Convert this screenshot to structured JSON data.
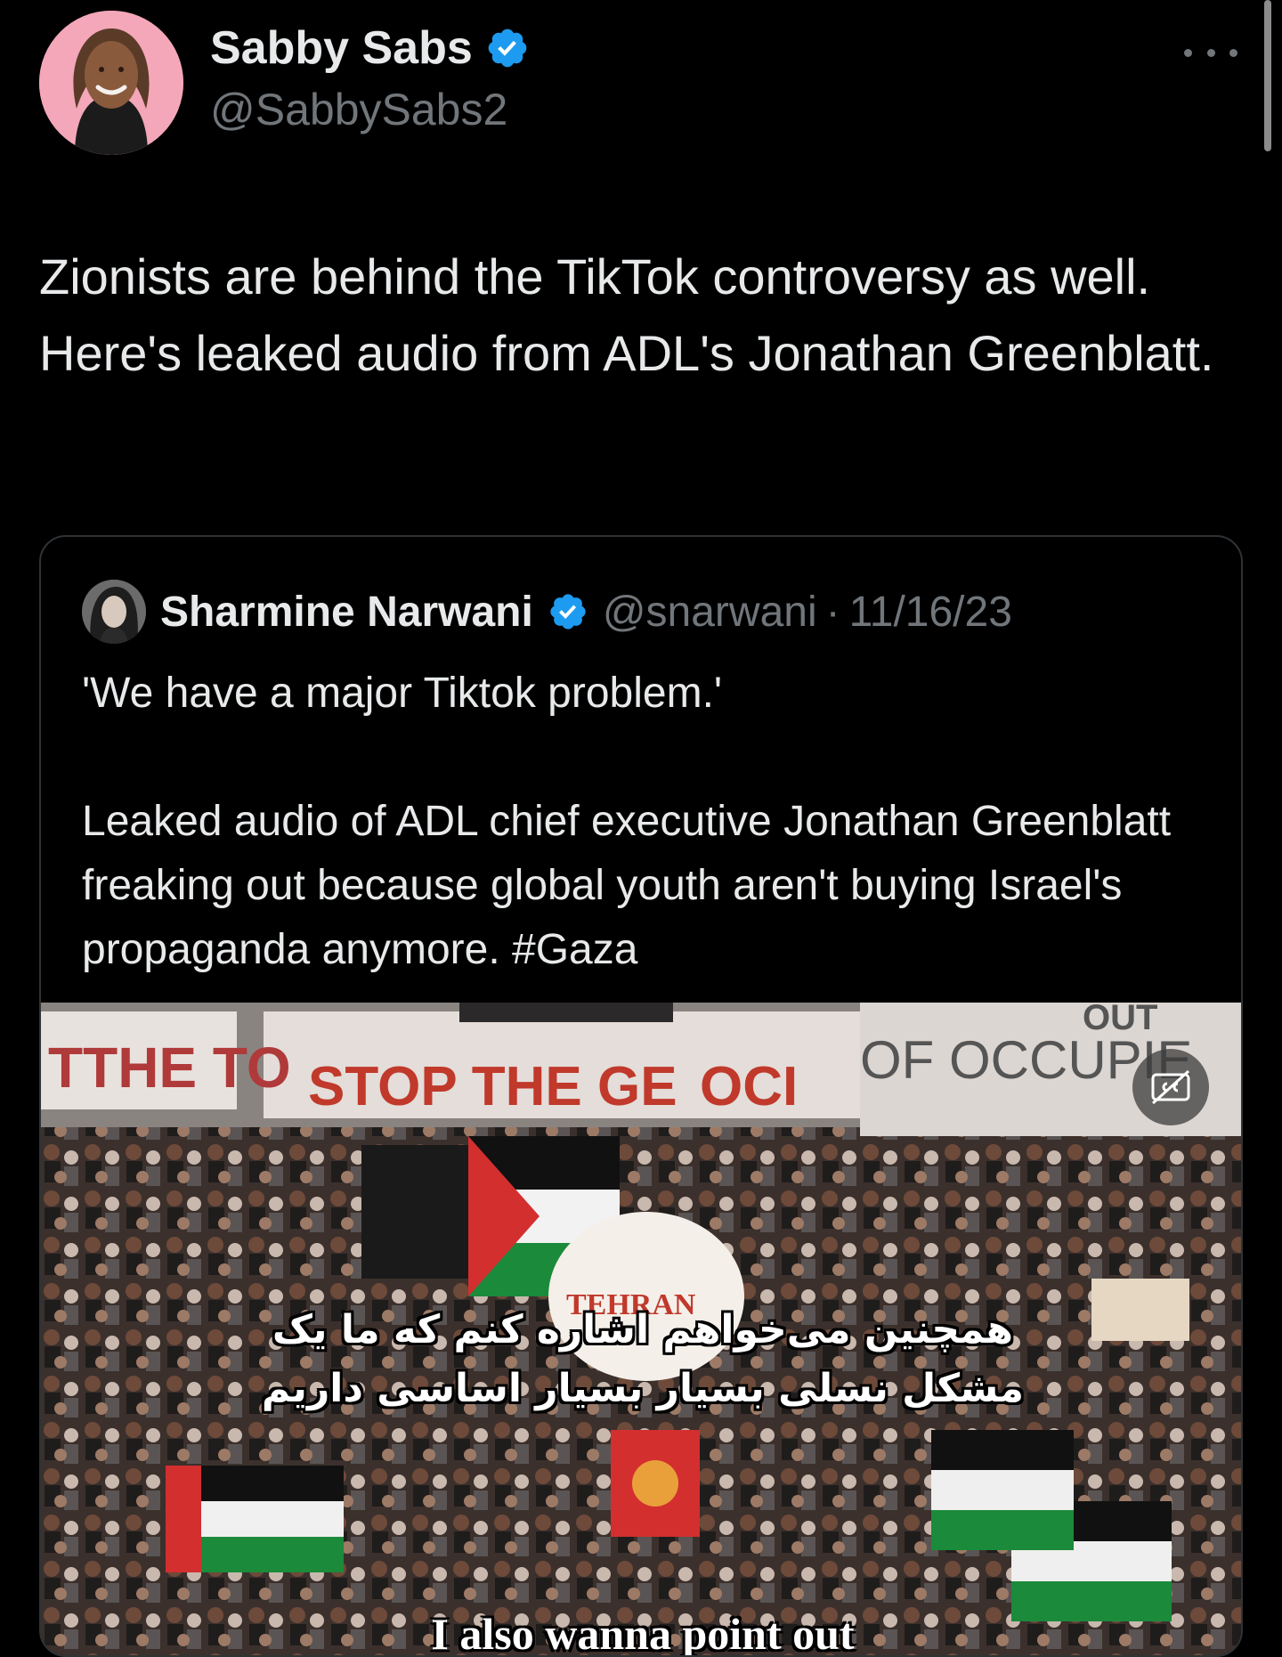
{
  "tweet": {
    "author": {
      "name": "Sabby Sabs",
      "handle": "@SabbySabs2",
      "verified": true,
      "avatar_bg": "#f4a7b9"
    },
    "text": "Zionists are behind the TikTok controversy as well. Here's leaked audio from ADL's Jonathan Greenblatt.",
    "more_icon": "more-horizontal-icon"
  },
  "quote": {
    "author": {
      "name": "Sharmine Narwani",
      "handle": "@snarwani",
      "separator": "·",
      "date": "11/16/23",
      "verified": true
    },
    "paragraphs": [
      "'We have a major Tiktok problem.'",
      "Leaked audio of ADL chief executive Jonathan Greenblatt freaking out because global youth aren't buying Israel's propaganda anymore. #Gaza"
    ],
    "video": {
      "caption_icon": "closed-captions-icon",
      "banner_left": "STOP THE GE",
      "banner_left_end": "OCI",
      "banner_right_top": "OUT",
      "banner_right": "OF OCCUPIE",
      "banner_far_left": "TTHE TO",
      "subtitle_persian_lines": [
        "همچنین می‌خواهم اشاره کنم که ما یک",
        "مشکل نسلی بسیار بسیار اساسی داریم"
      ],
      "subtitle_english": "I also wanna point out",
      "sign_text": "TEHRAN"
    }
  },
  "colors": {
    "background": "#000000",
    "text_primary": "#e7e9ea",
    "text_secondary": "#71767b",
    "verified": "#1d9bf0",
    "border": "#2f3336"
  }
}
